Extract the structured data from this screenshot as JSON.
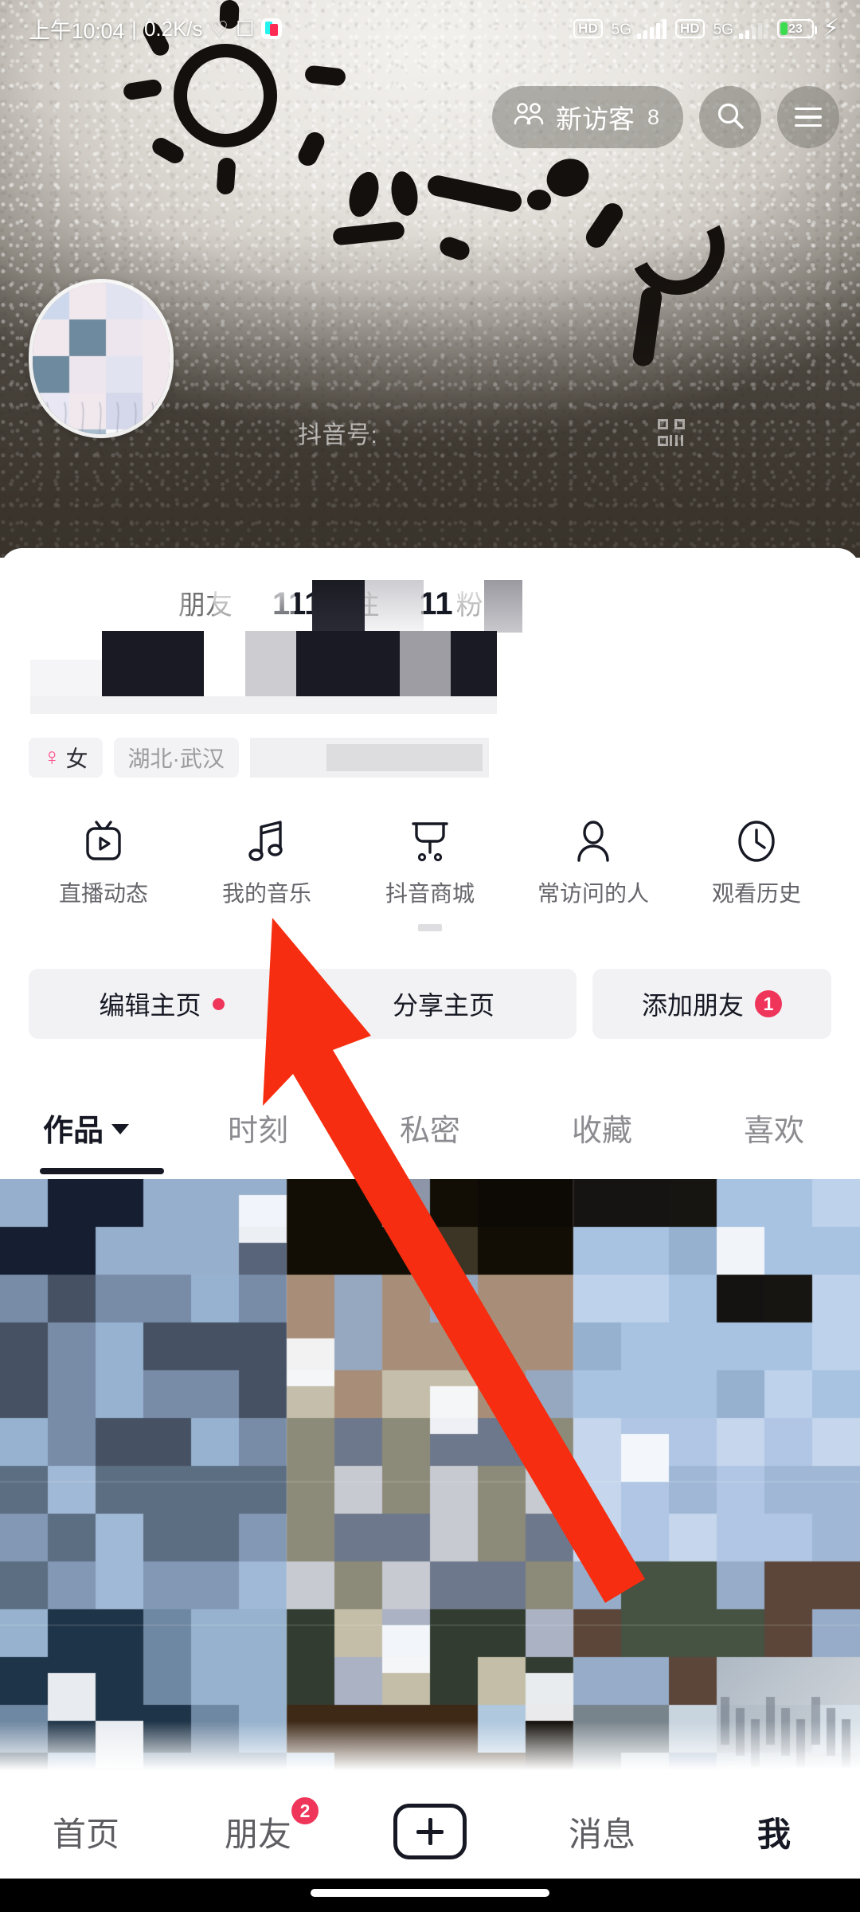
{
  "status_bar": {
    "time": "上午10:04",
    "net_speed": "0.2K/s",
    "left_icons": [
      "heart-circle-icon",
      "app-square-icon",
      "douyin-app-icon"
    ],
    "sim1": {
      "hd": "HD",
      "network": "5G"
    },
    "sim2": {
      "hd": "HD",
      "network": "5G"
    },
    "battery_percent": "23",
    "charging": true
  },
  "header": {
    "visitor_label": "新访客",
    "visitor_count": "8",
    "search_icon": "search-icon",
    "menu_icon": "hamburger-menu-icon"
  },
  "profile": {
    "douyin_id_label": "抖音号:",
    "qr_icon": "qr-code-icon",
    "avatar": "user-avatar"
  },
  "stats": [
    {
      "num": "",
      "label": "朋友"
    },
    {
      "num": "111",
      "label": "关注"
    },
    {
      "num": "11",
      "label": "粉丝"
    }
  ],
  "tags": {
    "gender": "女",
    "gender_icon": "female-symbol-icon",
    "location": "湖北·武汉"
  },
  "quick_actions": [
    {
      "label": "直播动态",
      "icon": "live-tv-icon"
    },
    {
      "label": "我的音乐",
      "icon": "music-note-icon"
    },
    {
      "label": "抖音商城",
      "icon": "shopping-cart-icon"
    },
    {
      "label": "常访问的人",
      "icon": "person-icon"
    },
    {
      "label": "观看历史",
      "icon": "clock-icon"
    }
  ],
  "action_buttons": [
    {
      "label": "编辑主页",
      "badge": "",
      "dot": true
    },
    {
      "label": "分享主页",
      "badge": "",
      "dot": false
    },
    {
      "label": "添加朋友",
      "badge": "1",
      "dot": false
    }
  ],
  "tabs": [
    {
      "label": "作品",
      "active": true,
      "caret": true
    },
    {
      "label": "时刻",
      "active": false,
      "caret": false
    },
    {
      "label": "私密",
      "active": false,
      "caret": false
    },
    {
      "label": "收藏",
      "active": false,
      "caret": false
    },
    {
      "label": "喜欢",
      "active": false,
      "caret": false
    }
  ],
  "bottom_nav": [
    {
      "label": "首页",
      "active": false,
      "badge": ""
    },
    {
      "label": "朋友",
      "active": false,
      "badge": "2"
    },
    {
      "label": "",
      "active": false,
      "badge": "",
      "icon": "plus-create-icon"
    },
    {
      "label": "消息",
      "active": false,
      "badge": ""
    },
    {
      "label": "我",
      "active": true,
      "badge": ""
    }
  ],
  "annotation": {
    "type": "red-arrow",
    "color": "#F62D10",
    "points_to": "我的音乐"
  },
  "colors": {
    "accent_red": "#F0355A",
    "annotation_red": "#F62D10",
    "text_primary": "#161823",
    "text_secondary": "#707070",
    "chip_bg": "#F2F2F4",
    "battery_green": "#3DDC50",
    "female_pink": "#FF4F8B"
  }
}
